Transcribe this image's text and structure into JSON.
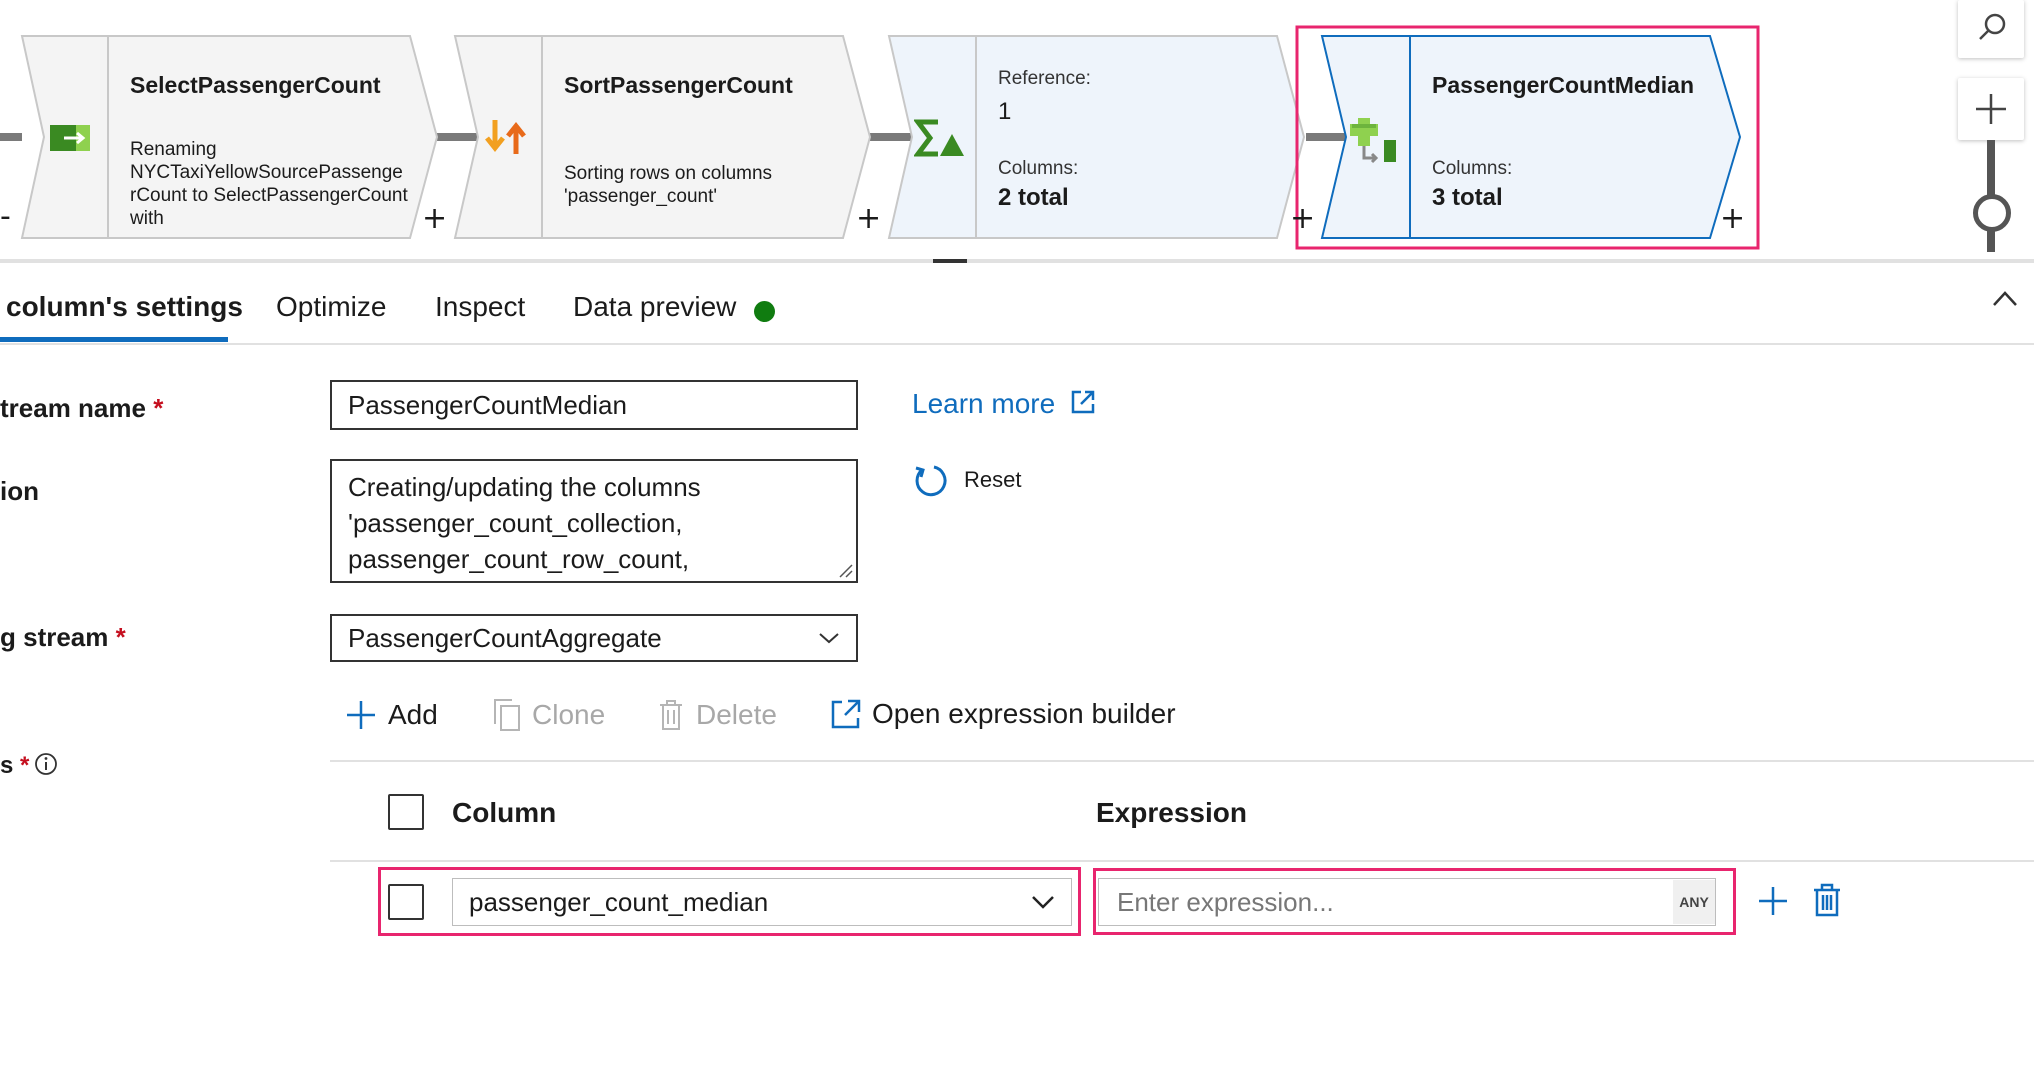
{
  "flow": {
    "nodes": [
      {
        "title": "SelectPassengerCount",
        "description": "Renaming NYCTaxiYellowSourcePassenge rCount to SelectPassengerCount with"
      },
      {
        "title": "SortPassengerCount",
        "description": "Sorting rows on columns 'passenger_count'"
      },
      {
        "reference_label": "Reference:",
        "reference_value": "1",
        "columns_label": "Columns:",
        "columns_value": "2 total"
      },
      {
        "title": "PassengerCountMedian",
        "columns_label": "Columns:",
        "columns_value": "3 total"
      }
    ],
    "plus_symbol": "+",
    "minus_symbol": "-",
    "zoom_in_symbol": "+"
  },
  "tabs": [
    {
      "label": "column's settings",
      "active": true
    },
    {
      "label": "Optimize"
    },
    {
      "label": "Inspect"
    },
    {
      "label": "Data preview",
      "status_color": "#107c10"
    }
  ],
  "form": {
    "stream_name_label": "tream name",
    "required_mark": "*",
    "stream_name_value": "PassengerCountMedian",
    "description_label": "ion",
    "description_value": "Creating/updating the columns 'passenger_count_collection, passenger_count_row_count,",
    "incoming_stream_label": "g stream",
    "incoming_stream_value": "PassengerCountAggregate",
    "columns_label": "s",
    "learn_more": "Learn more",
    "reset": "Reset"
  },
  "toolbar": {
    "add": "Add",
    "clone": "Clone",
    "delete": "Delete",
    "open_expression_builder": "Open expression builder"
  },
  "grid": {
    "column_header": "Column",
    "expression_header": "Expression",
    "rows": [
      {
        "column_value": "passenger_count_median",
        "expression_placeholder": "Enter expression...",
        "type_badge": "ANY"
      }
    ]
  },
  "colors": {
    "accent": "#0f6cbd",
    "highlight": "#e8256e",
    "node_selected_fill": "#eef4fb",
    "node_fill": "#f4f4f4"
  }
}
